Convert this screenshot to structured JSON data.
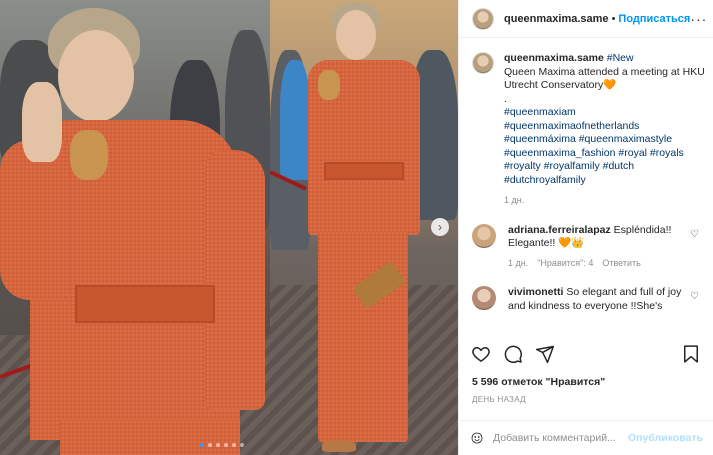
{
  "post": {
    "username": "queenmaxima.same",
    "separator": "•",
    "follow_label": "Подписаться",
    "more_label": "···",
    "caption_username": "queenmaxima.same",
    "caption_lines": [
      "#New",
      "Queen Maxima attended a meeting at HKU Utrecht Conservatory🧡",
      ".",
      "#queenmaxiam",
      "#queenmaximaofnetherlands",
      "#queenmáxima #queenmaximastyle",
      "#queenmaxima_fashion #royal #royals",
      "#royalty #royalfamily #dutch",
      "#dutchroyalfamily"
    ],
    "caption_time": "1 дн."
  },
  "comments": [
    {
      "username": "adriana.ferreiralapaz",
      "text": "Espléndida!! Elegante!! 🧡👑",
      "likes_label": "\"Нравится\": 4",
      "reply_label": "Ответить",
      "time": "1 дн.",
      "avatar_color": "#c9a37b"
    },
    {
      "username": "vivimonetti",
      "text": "So elegant and full of joy and kindness to everyone !!She's",
      "avatar_color": "#b48a74"
    }
  ],
  "stats": {
    "likes_text": "5 596 отметок \"Нравится\"",
    "date_text": "ДЕНЬ НАЗАД"
  },
  "composer": {
    "placeholder": "Добавить комментарий...",
    "publish_label": "Опубликовать"
  },
  "carousel": {
    "total_slides": 6,
    "active_index": 0,
    "next_arrow": "›"
  },
  "colors": {
    "accent": "#0095f6",
    "hashtag": "#00376b",
    "muted": "#8e8e8e",
    "publish_disabled": "#b2dffc",
    "suit": "#d9643c"
  }
}
